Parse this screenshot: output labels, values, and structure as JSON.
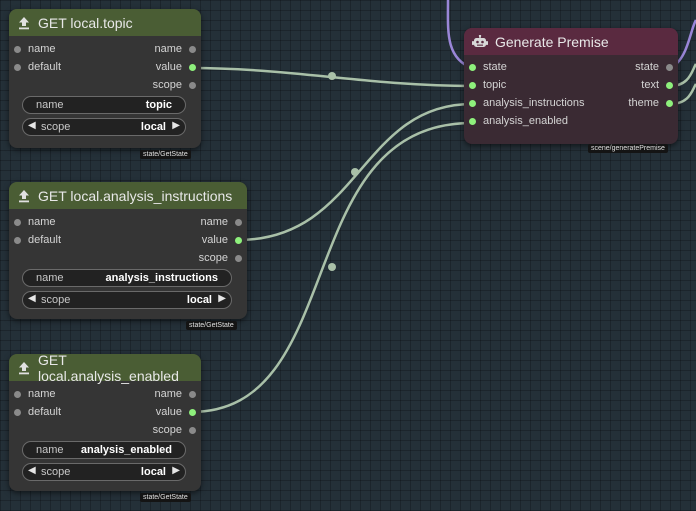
{
  "canvas": {
    "background": "#243038",
    "wire_color": "#a9c0a8",
    "wire_color_purple": "#9a86d8"
  },
  "nodes": {
    "get_topic": {
      "title": "GET local.topic",
      "icon": "upload-icon",
      "inputs": [
        "name",
        "default"
      ],
      "outputs": [
        "name",
        "value",
        "scope"
      ],
      "widget_name": {
        "label": "name",
        "value": "topic"
      },
      "widget_scope": {
        "label": "scope",
        "value": "local"
      },
      "tag": "state/GetState"
    },
    "get_analysis_instructions": {
      "title": "GET local.analysis_instructions",
      "icon": "upload-icon",
      "inputs": [
        "name",
        "default"
      ],
      "outputs": [
        "name",
        "value",
        "scope"
      ],
      "widget_name": {
        "label": "name",
        "value": "analysis_instructions"
      },
      "widget_scope": {
        "label": "scope",
        "value": "local"
      },
      "tag": "state/GetState"
    },
    "get_analysis_enabled": {
      "title": "GET local.analysis_enabled",
      "icon": "upload-icon",
      "inputs": [
        "name",
        "default"
      ],
      "outputs": [
        "name",
        "value",
        "scope"
      ],
      "widget_name": {
        "label": "name",
        "value": "analysis_enabled"
      },
      "widget_scope": {
        "label": "scope",
        "value": "local"
      },
      "tag": "state/GetState"
    },
    "generate_premise": {
      "title": "Generate Premise",
      "icon": "robot-icon",
      "inputs": [
        "state",
        "topic",
        "analysis_instructions",
        "analysis_enabled"
      ],
      "outputs": [
        "state",
        "text",
        "theme"
      ],
      "tag": "scene/generatePremise"
    }
  },
  "arrows": {
    "left": "◀",
    "right": "▶"
  }
}
